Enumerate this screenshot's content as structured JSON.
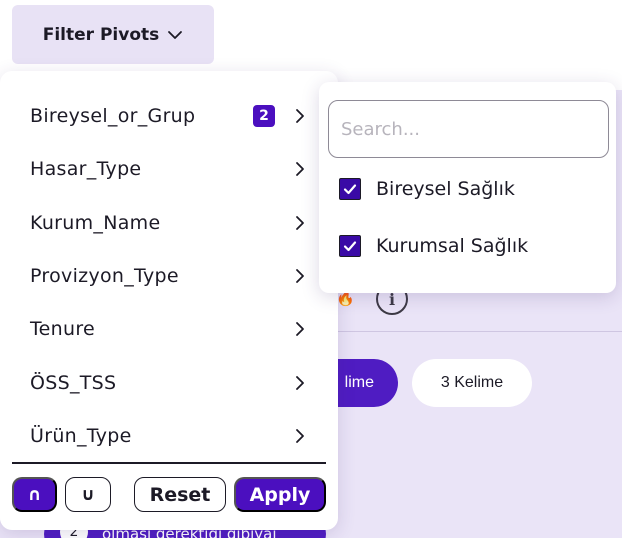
{
  "filter_button": {
    "label": "Filter Pivots",
    "icon": "chevron-down-icon"
  },
  "pivots": [
    {
      "label": "Bireysel_or_Grup",
      "badge": "2"
    },
    {
      "label": "Hasar_Type",
      "badge": ""
    },
    {
      "label": "Kurum_Name",
      "badge": ""
    },
    {
      "label": "Provizyon_Type",
      "badge": ""
    },
    {
      "label": "Tenure",
      "badge": ""
    },
    {
      "label": "ÖSS_TSS",
      "badge": ""
    },
    {
      "label": "Ürün_Type",
      "badge": ""
    }
  ],
  "footer": {
    "intersect_label": "∩",
    "union_label": "∪",
    "reset_label": "Reset",
    "apply_label": "Apply"
  },
  "submenu": {
    "search_placeholder": "Search...",
    "search_value": "",
    "options": [
      {
        "label": "Bireysel Sağlık",
        "checked": true
      },
      {
        "label": "Kurumsal Sağlık",
        "checked": true
      }
    ]
  },
  "background": {
    "chip_selected": "lime",
    "chip_other": "3 Kelime",
    "bottom_badge": "2",
    "bottom_text": "olması gerektiği gibiyai"
  },
  "colors": {
    "accent": "#4b0fbf",
    "panel_bg": "#eae4f7",
    "button_bg": "#e8e2f5",
    "text": "#1c1a26"
  }
}
